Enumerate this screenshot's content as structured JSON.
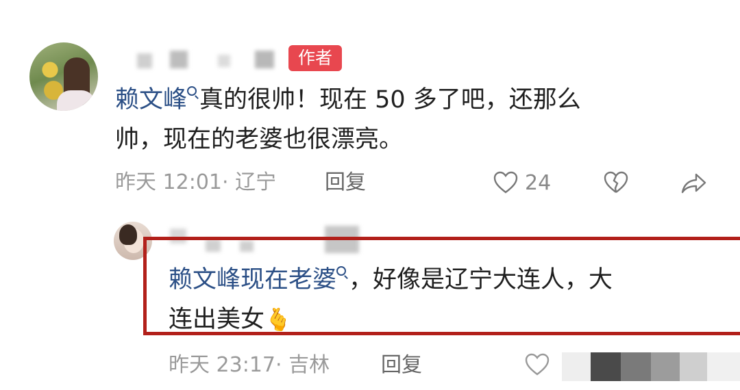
{
  "comment": {
    "author_tag": "作者",
    "mention": "赖文峰",
    "text_line1": "真的很帅！现在 50 多了吧，还那么",
    "text_line2": "帅，现在的老婆也很漂亮。",
    "timestamp": "昨天 12:01· 辽宁",
    "reply_label": "回复",
    "like_count": "24"
  },
  "reply": {
    "mention": "赖文峰现在老婆",
    "text_line1_rest": "，好像是辽宁大连人，大",
    "text_line2": "连出美女",
    "emoji": "🫰",
    "timestamp": "昨天 23:17· 吉林",
    "reply_label": "回复"
  },
  "colors": {
    "mention": "#2b4f86",
    "author_tag_bg": "#e8474f",
    "highlight_box": "#b2201a",
    "meta_text": "#9a9a9a"
  },
  "icons": [
    "search-icon",
    "heart-icon",
    "broken-heart-icon",
    "share-icon",
    "finger-heart-emoji"
  ]
}
